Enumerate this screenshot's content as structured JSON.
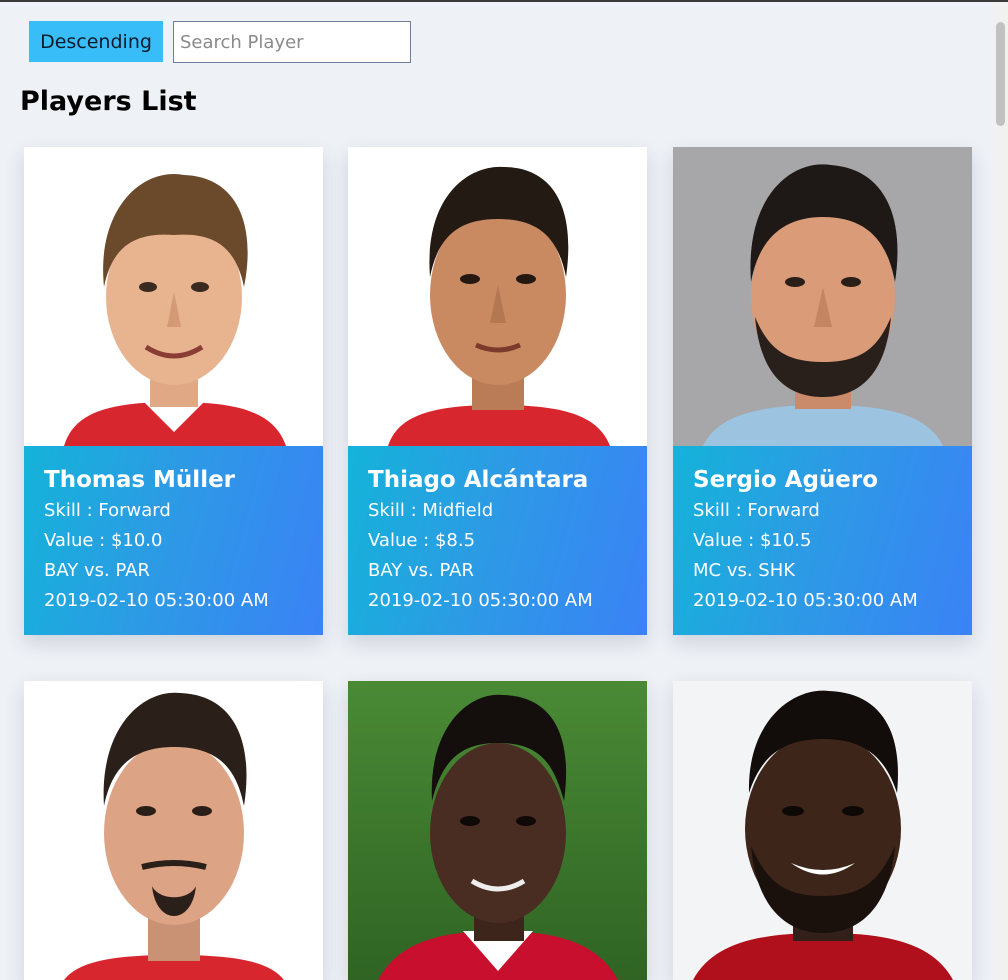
{
  "controls": {
    "sort_label": "Descending",
    "search_placeholder": "Search Player",
    "search_value": ""
  },
  "page_title": "Players List",
  "players": [
    {
      "name": "Thomas Müller",
      "skill": "Skill : Forward",
      "value": "Value : $10.0",
      "match": "BAY vs. PAR",
      "date": "2019-02-10 05:30:00 AM",
      "photo_bg": "#ffffff",
      "skin": "#e8b48f",
      "hair": "#6b4a2c",
      "shirt": "#d7262e"
    },
    {
      "name": "Thiago Alcántara",
      "skill": "Skill : Midfield",
      "value": "Value : $8.5",
      "match": "BAY vs. PAR",
      "date": "2019-02-10 05:30:00 AM",
      "photo_bg": "#ffffff",
      "skin": "#c98a62",
      "hair": "#231a14",
      "shirt": "#d7262e"
    },
    {
      "name": "Sergio Agüero",
      "skill": "Skill : Forward",
      "value": "Value : $10.5",
      "match": "MC vs. SHK",
      "date": "2019-02-10 05:30:00 AM",
      "photo_bg": "#a7a7a9",
      "skin": "#d99b78",
      "hair": "#1e1916",
      "shirt": "#9cc3e0"
    },
    {
      "name": "",
      "skill": "",
      "value": "",
      "match": "",
      "date": "",
      "photo_bg": "#ffffff",
      "skin": "#dca384",
      "hair": "#2b2019",
      "shirt": "#d7262e"
    },
    {
      "name": "",
      "skill": "",
      "value": "",
      "match": "",
      "date": "",
      "photo_bg": "#3f7a2d",
      "skin": "#4a2d22",
      "hair": "#140e0c",
      "shirt": "#c8102e"
    },
    {
      "name": "",
      "skill": "",
      "value": "",
      "match": "",
      "date": "",
      "photo_bg": "#f2f4f6",
      "skin": "#3e2519",
      "hair": "#120c0a",
      "shirt": "#b0101c"
    }
  ]
}
